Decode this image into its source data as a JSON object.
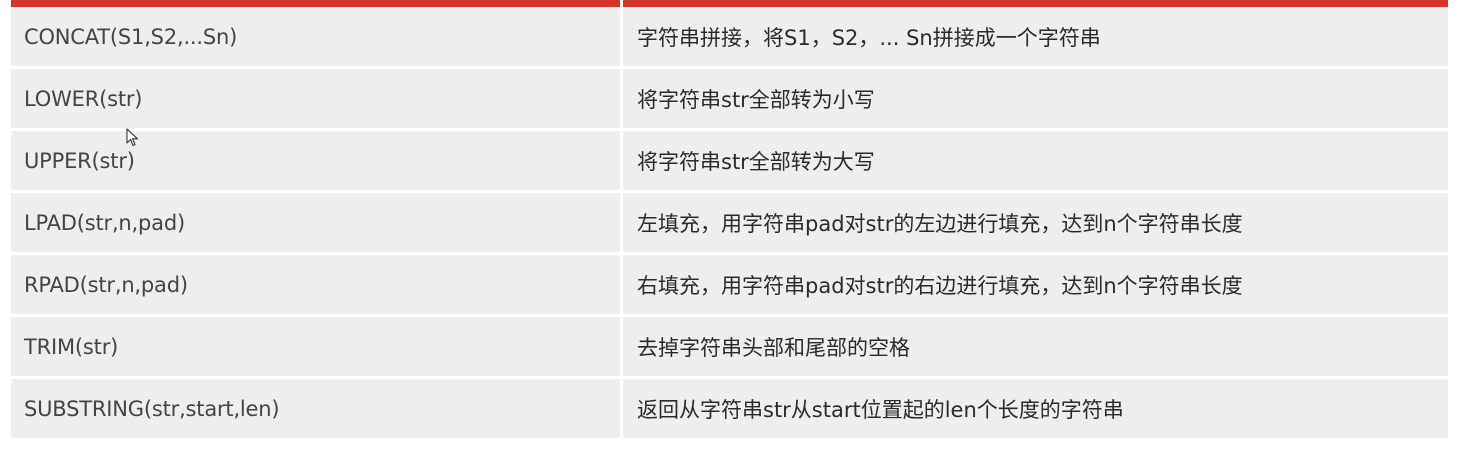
{
  "table": {
    "rows": [
      {
        "function": "CONCAT(S1,S2,...Sn)",
        "description": "字符串拼接，将S1，S2，... Sn拼接成一个字符串"
      },
      {
        "function": "LOWER(str)",
        "description": "将字符串str全部转为小写"
      },
      {
        "function": "UPPER(str)",
        "description": "将字符串str全部转为大写"
      },
      {
        "function": "LPAD(str,n,pad)",
        "description": "左填充，用字符串pad对str的左边进行填充，达到n个字符串长度"
      },
      {
        "function": "RPAD(str,n,pad)",
        "description": "右填充，用字符串pad对str的右边进行填充，达到n个字符串长度"
      },
      {
        "function": "TRIM(str)",
        "description": "去掉字符串头部和尾部的空格"
      },
      {
        "function": "SUBSTRING(str,start,len)",
        "description": "返回从字符串str从start位置起的len个长度的字符串"
      }
    ]
  },
  "colors": {
    "header_accent": "#d8332a",
    "cell_background": "#eeeeee",
    "text": "#444444"
  },
  "icons": {
    "cursor": "mouse-pointer-icon"
  }
}
